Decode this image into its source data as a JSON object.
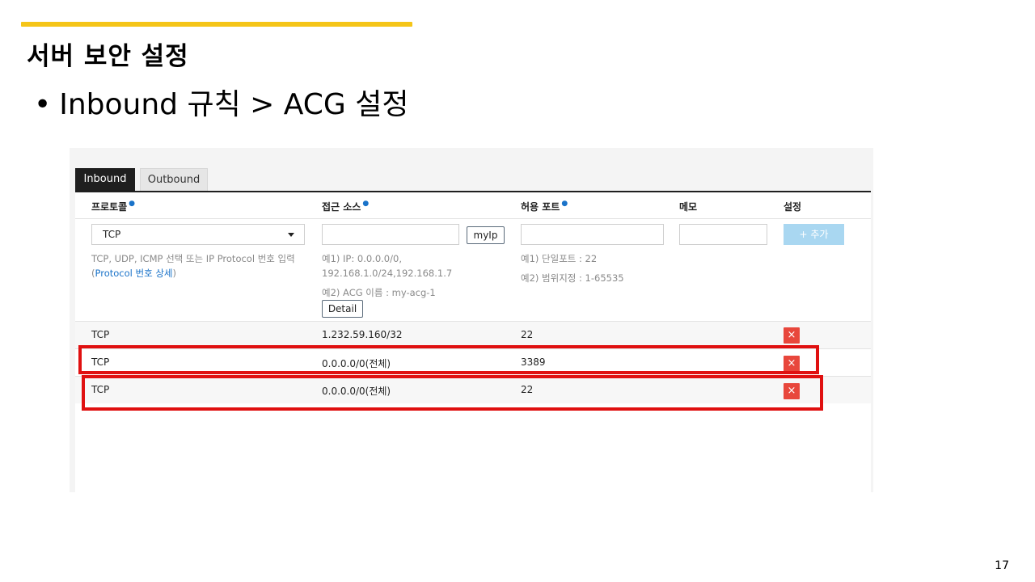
{
  "slide": {
    "title": "서버 보안 설정",
    "bullet_dot": "•",
    "bullet_text": "Inbound 규칙 > ACG 설정",
    "page_number": "17",
    "accent_color": "#f5c518"
  },
  "tabs": [
    {
      "label": "Inbound",
      "active": true
    },
    {
      "label": "Outbound",
      "active": false
    }
  ],
  "columns": {
    "protocol": "프로토콜",
    "source": "접근 소스",
    "port": "허용 포트",
    "memo": "메모",
    "settings": "설정",
    "required_mark": "●"
  },
  "form": {
    "protocol_select_value": "TCP",
    "protocol_help_1": "TCP, UDP, ICMP 선택 또는 IP Protocol 번호 입력",
    "protocol_help_paren_open": "(",
    "protocol_help_link": "Protocol 번호 상세",
    "protocol_help_paren_close": ")",
    "myip_button": "myIp",
    "source_help_1": "예1) IP: 0.0.0.0/0,",
    "source_help_2": "192.168.1.0/24,192.168.1.7",
    "source_help_3": "예2) ACG 이름 : my-acg-1",
    "detail_button": "Detail",
    "port_help_1": "예1) 단일포트 : 22",
    "port_help_2": "예2) 범위지정 : 1-65535",
    "add_button": "+ 추가"
  },
  "rules": [
    {
      "protocol": "TCP",
      "source": "1.232.59.160/32",
      "port": "22",
      "memo": ""
    },
    {
      "protocol": "TCP",
      "source": "0.0.0.0/0(전체)",
      "port": "3389",
      "memo": ""
    },
    {
      "protocol": "TCP",
      "source": "0.0.0.0/0(전체)",
      "port": "22",
      "memo": ""
    }
  ],
  "delete_icon": "×",
  "colors": {
    "highlight": "#e01010",
    "delete": "#e8473c",
    "add_button": "#a9d7f1",
    "link": "#1a73c9"
  }
}
